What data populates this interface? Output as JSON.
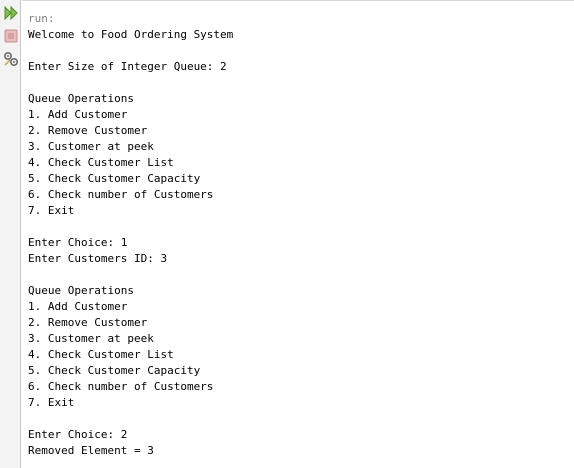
{
  "toolbar": {
    "buttons": [
      {
        "icon": "rerun-icon",
        "color": "#6aa84f"
      },
      {
        "icon": "stop-icon",
        "color": "#d9a6a6"
      },
      {
        "icon": "settings-icon",
        "color": "#7a7a7a"
      }
    ]
  },
  "console": {
    "header": "run:",
    "lines": [
      "Welcome to Food Ordering System",
      "",
      "Enter Size of Integer Queue: 2",
      "",
      "Queue Operations",
      "1. Add Customer",
      "2. Remove Customer",
      "3. Customer at peek",
      "4. Check Customer List",
      "5. Check Customer Capacity",
      "6. Check number of Customers",
      "7. Exit",
      "",
      "Enter Choice: 1",
      "Enter Customers ID: 3",
      "",
      "Queue Operations",
      "1. Add Customer",
      "2. Remove Customer",
      "3. Customer at peek",
      "4. Check Customer List",
      "5. Check Customer Capacity",
      "6. Check number of Customers",
      "7. Exit",
      "",
      "Enter Choice: 2",
      "Removed Element = 3"
    ]
  }
}
